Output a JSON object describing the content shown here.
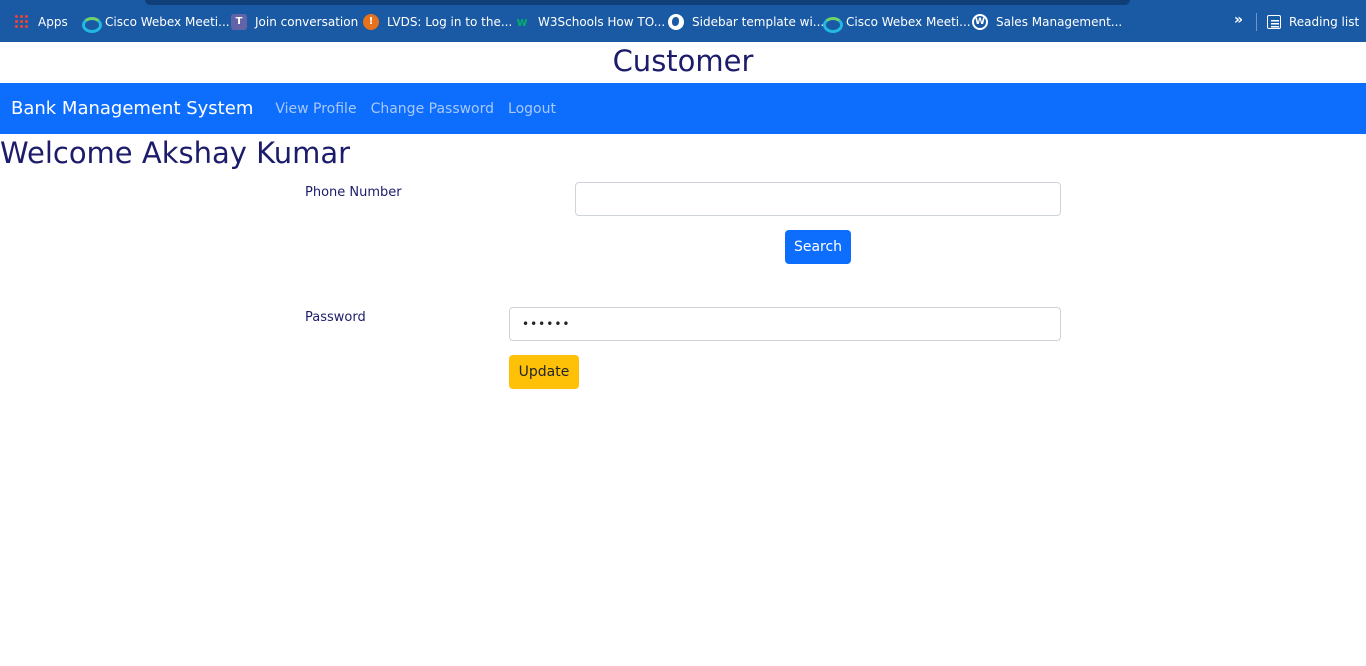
{
  "browser": {
    "bookmarks": [
      {
        "label": "Apps",
        "icon": "apps-grid-icon"
      },
      {
        "label": "Cisco Webex Meeti...",
        "icon": "webex-icon"
      },
      {
        "label": "Join conversation",
        "icon": "teams-icon"
      },
      {
        "label": "LVDS: Log in to the...",
        "icon": "lvds-icon"
      },
      {
        "label": "W3Schools How TO...",
        "icon": "w3schools-icon"
      },
      {
        "label": "Sidebar template wi...",
        "icon": "globe-icon"
      },
      {
        "label": "Cisco Webex Meeti...",
        "icon": "webex-icon"
      },
      {
        "label": "Sales Management...",
        "icon": "wordpress-icon"
      }
    ],
    "overflow_glyph": "»",
    "reading_list": "Reading list"
  },
  "page": {
    "title": "Customer",
    "welcome": "Welcome Akshay Kumar"
  },
  "navbar": {
    "brand": "Bank Management System",
    "links": [
      "View Profile",
      "Change Password",
      "Logout"
    ],
    "color": "#0d6efd"
  },
  "search_form": {
    "label": "Phone Number",
    "value": "",
    "button": "Search"
  },
  "password_form": {
    "label": "Password",
    "value": "••••••",
    "button": "Update"
  }
}
